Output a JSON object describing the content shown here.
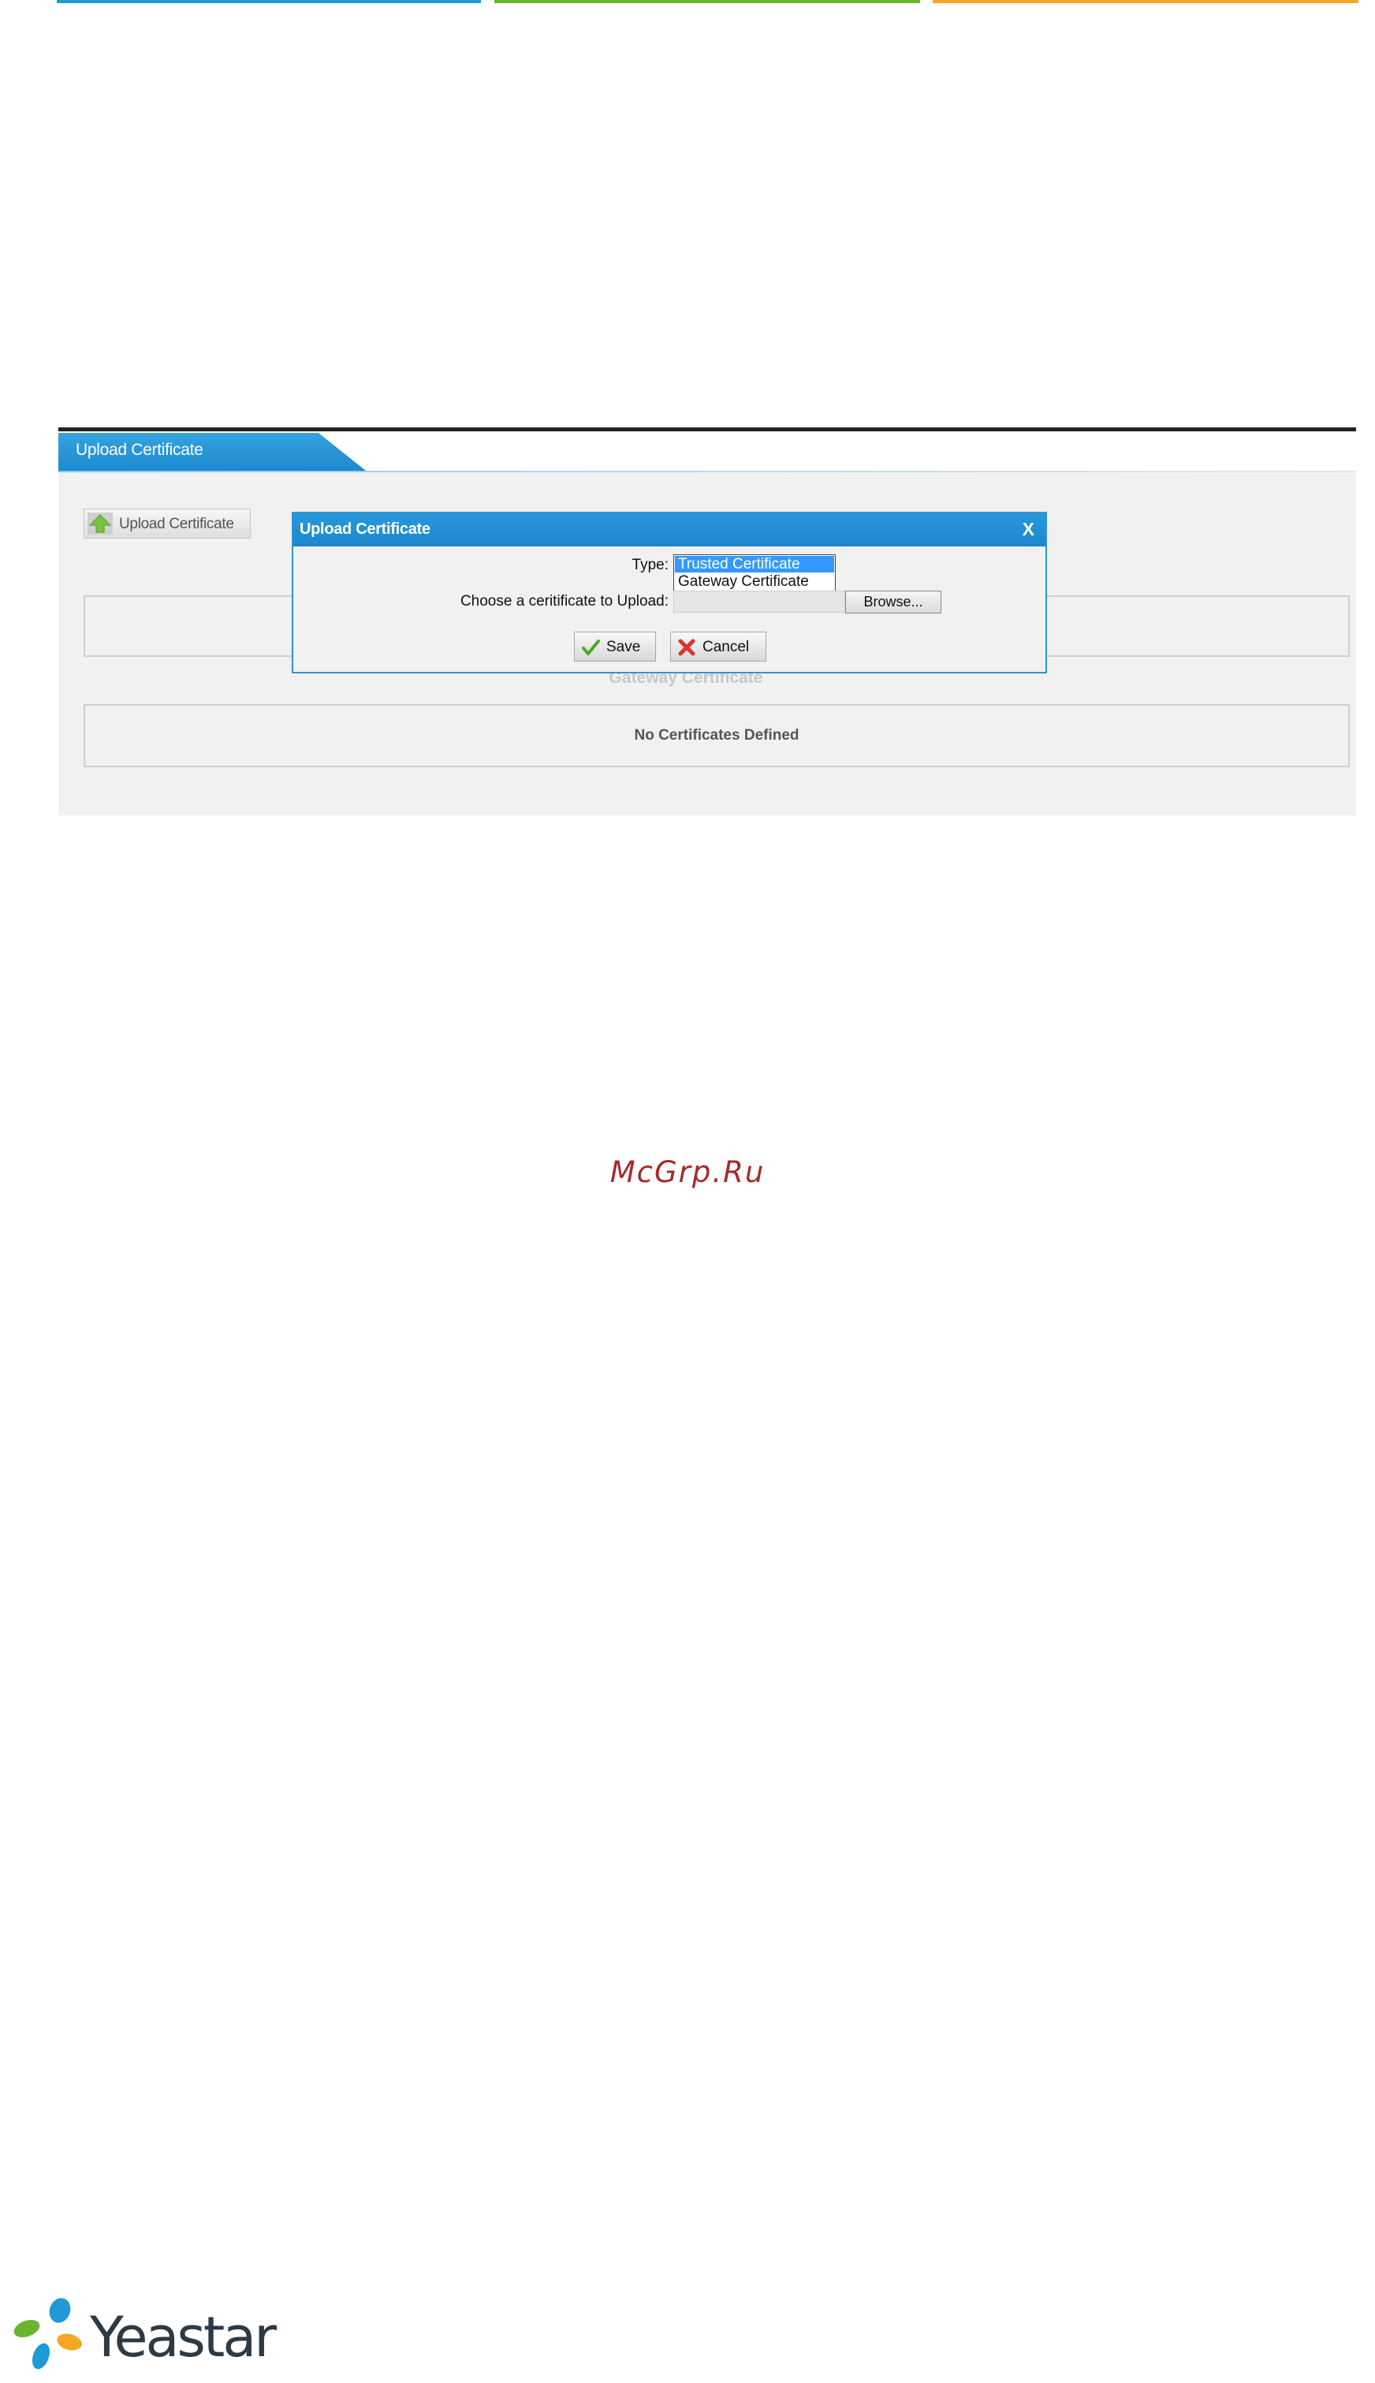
{
  "colors": {
    "blue": "#1f9ad6",
    "green": "#6ab52e",
    "orange": "#f5a623",
    "dialog_blue": "#2e93d4",
    "watermark": "#a52a2a"
  },
  "screen": {
    "tab_title": "Upload Certificate",
    "upload_button": {
      "label": "Upload Certificate",
      "icon": "upload-arrow-icon"
    },
    "gateway_heading": "Gateway Certificate",
    "gateway_empty_message": "No Certificates Defined"
  },
  "dialog": {
    "title": "Upload Certificate",
    "close": "X",
    "type_label": "Type:",
    "type_options": [
      "Trusted Certificate",
      "Gateway Certificate"
    ],
    "type_selected": "Trusted Certificate",
    "choose_label": "Choose a ceritificate to Upload:",
    "browse_label": "Browse...",
    "save_label": "Save",
    "cancel_label": "Cancel"
  },
  "watermark": "McGrp.Ru",
  "logo": {
    "text": "Yeastar"
  }
}
